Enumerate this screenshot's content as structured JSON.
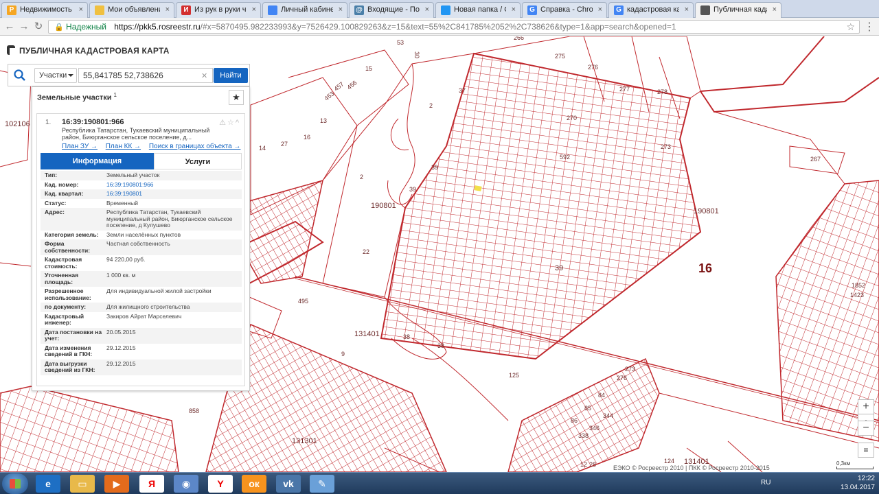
{
  "browser": {
    "tabs": [
      {
        "title": "Недвижимость Н",
        "icon_color": "#f5a623",
        "icon_letter": "P"
      },
      {
        "title": "Мои объявления",
        "icon_color": "#f0c040",
        "icon_letter": ""
      },
      {
        "title": "Из рук в руки ча",
        "icon_color": "#d32f2f",
        "icon_letter": "И"
      },
      {
        "title": "Личный кабинет",
        "icon_color": "#4285f4",
        "icon_letter": ""
      },
      {
        "title": "Входящие - Почт",
        "icon_color": "#4a7fa8",
        "icon_letter": "@"
      },
      {
        "title": "Новая папка / Ол",
        "icon_color": "#2196f3",
        "icon_letter": ""
      },
      {
        "title": "Справка - Chrom",
        "icon_color": "#4285f4",
        "icon_letter": "G"
      },
      {
        "title": "кадастровая карт",
        "icon_color": "#4285f4",
        "icon_letter": "G"
      },
      {
        "title": "Публичная кадас",
        "icon_color": "#555555",
        "icon_letter": ""
      }
    ],
    "secure_label": "Надежный",
    "url_host": "https://pkk5.rosreestr.ru",
    "url_rest": "/#x=5870495.982233993&y=7526429.100829263&z=15&text=55%2C841785%2052%2C738626&type=1&app=search&opened=1"
  },
  "app": {
    "title": "ПУБЛИЧНАЯ КАДАСТРОВАЯ КАРТА",
    "search": {
      "type_label": "Участки",
      "value": "55,841785 52,738626",
      "find_label": "Найти"
    },
    "panel": {
      "heading": "Земельные участки",
      "count": "1",
      "item_number": "1.",
      "cad_number": "16:39:190801:966",
      "address_short": "Республика Татарстан, Тукаевский муниципальный район, Биюрганское сельское поселение, д...",
      "links": [
        "План ЗУ →",
        "План КК →",
        "Поиск в границах объекта →"
      ],
      "tab_info": "Информация",
      "tab_services": "Услуги",
      "rows": [
        {
          "k": "Тип:",
          "v": "Земельный участок",
          "link": false
        },
        {
          "k": "Кад. номер:",
          "v": "16:39:190801:966",
          "link": true
        },
        {
          "k": "Кад. квартал:",
          "v": "16:39:190801",
          "link": true
        },
        {
          "k": "Статус:",
          "v": "Временный",
          "link": false
        },
        {
          "k": "Адрес:",
          "v": "Республика Татарстан, Тукаевский муниципальный район, Биюрганское сельское поселение, д Кулушево",
          "link": false
        },
        {
          "k": "Категория земель:",
          "v": "Земли населённых пунктов",
          "link": false
        },
        {
          "k": "Форма собственности:",
          "v": "Частная собственность",
          "link": false
        },
        {
          "k": "Кадастровая стоимость:",
          "v": "94 220,00 руб.",
          "link": false
        },
        {
          "k": "Уточненная площадь:",
          "v": "1 000 кв. м",
          "link": false
        },
        {
          "k": "Разрешенное использование:",
          "v": "Для индивидуальной жилой застройки",
          "link": false
        },
        {
          "k": "по документу:",
          "v": "Для жилищного строительства",
          "link": false
        },
        {
          "k": "Кадастровый инженер:",
          "v": "Закиров Айрат Марселевич",
          "link": false
        },
        {
          "k": "Дата постановки на учет:",
          "v": "20.05.2015",
          "link": false
        },
        {
          "k": "Дата изменения сведений в ГКН:",
          "v": "29.12.2015",
          "link": false
        },
        {
          "k": "Дата выгрузки сведений из ГКН:",
          "v": "29.12.2015",
          "link": false
        }
      ]
    }
  },
  "map": {
    "labels": [
      "53",
      "30",
      "266",
      "275",
      "276",
      "277",
      "278",
      "15",
      "457",
      "456",
      "453",
      "13",
      "2",
      "37",
      "270",
      "592",
      "273",
      "267",
      "190801",
      "190801",
      "16",
      "102106",
      "14",
      "27",
      "16",
      "39",
      "39",
      "2",
      "22",
      "39",
      "495",
      "131401",
      "38",
      "38",
      "9",
      "125",
      "273",
      "276",
      "84",
      "85",
      "86",
      "344",
      "346",
      "338",
      "858",
      "131301",
      "131401",
      "124",
      "28",
      "12",
      "1852",
      "1423"
    ],
    "zoom_in": "+",
    "zoom_out": "−",
    "scale": "0,3км",
    "copyright": "ЕЭКО © Росреестр 2010 | ПКК © Росреестр 2010-2015"
  },
  "taskbar": {
    "lang": "RU",
    "time": "12:22",
    "date": "13.04.2017"
  },
  "colors": {
    "map_line": "#c0282d",
    "accent": "#1565c0"
  }
}
